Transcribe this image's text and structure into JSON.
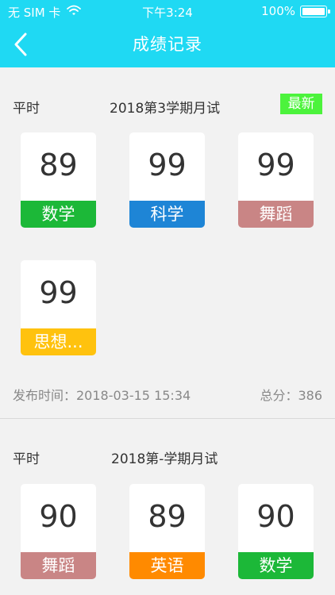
{
  "status_bar": {
    "carrier": "无 SIM 卡",
    "time": "下午3:24",
    "battery": "100%"
  },
  "nav": {
    "title": "成绩记录",
    "back_icon": "chevron-left-icon"
  },
  "colors": {
    "header": "#1fd9f3",
    "green": "#1cb838",
    "blue": "#1e85d6",
    "rose": "#c98585",
    "yellow": "#ffc20e",
    "orange": "#ff8a00",
    "badge": "#4cf33c"
  },
  "records": [
    {
      "type": "平时",
      "name": "2018第3学期月试",
      "badge": "最新",
      "scores": [
        {
          "score": "89",
          "subject": "数学",
          "color": "#1cb838"
        },
        {
          "score": "99",
          "subject": "科学",
          "color": "#1e85d6"
        },
        {
          "score": "99",
          "subject": "舞蹈",
          "color": "#c98585"
        },
        {
          "score": "99",
          "subject": "思想...",
          "color": "#ffc20e"
        }
      ],
      "publish_time": "发布时间：2018-03-15 15:34",
      "total": "总分：386"
    },
    {
      "type": "平时",
      "name": "2018第-学期月试",
      "scores": [
        {
          "score": "90",
          "subject": "舞蹈",
          "color": "#c98585"
        },
        {
          "score": "89",
          "subject": "英语",
          "color": "#ff8a00"
        },
        {
          "score": "90",
          "subject": "数学",
          "color": "#1cb838"
        }
      ]
    }
  ]
}
